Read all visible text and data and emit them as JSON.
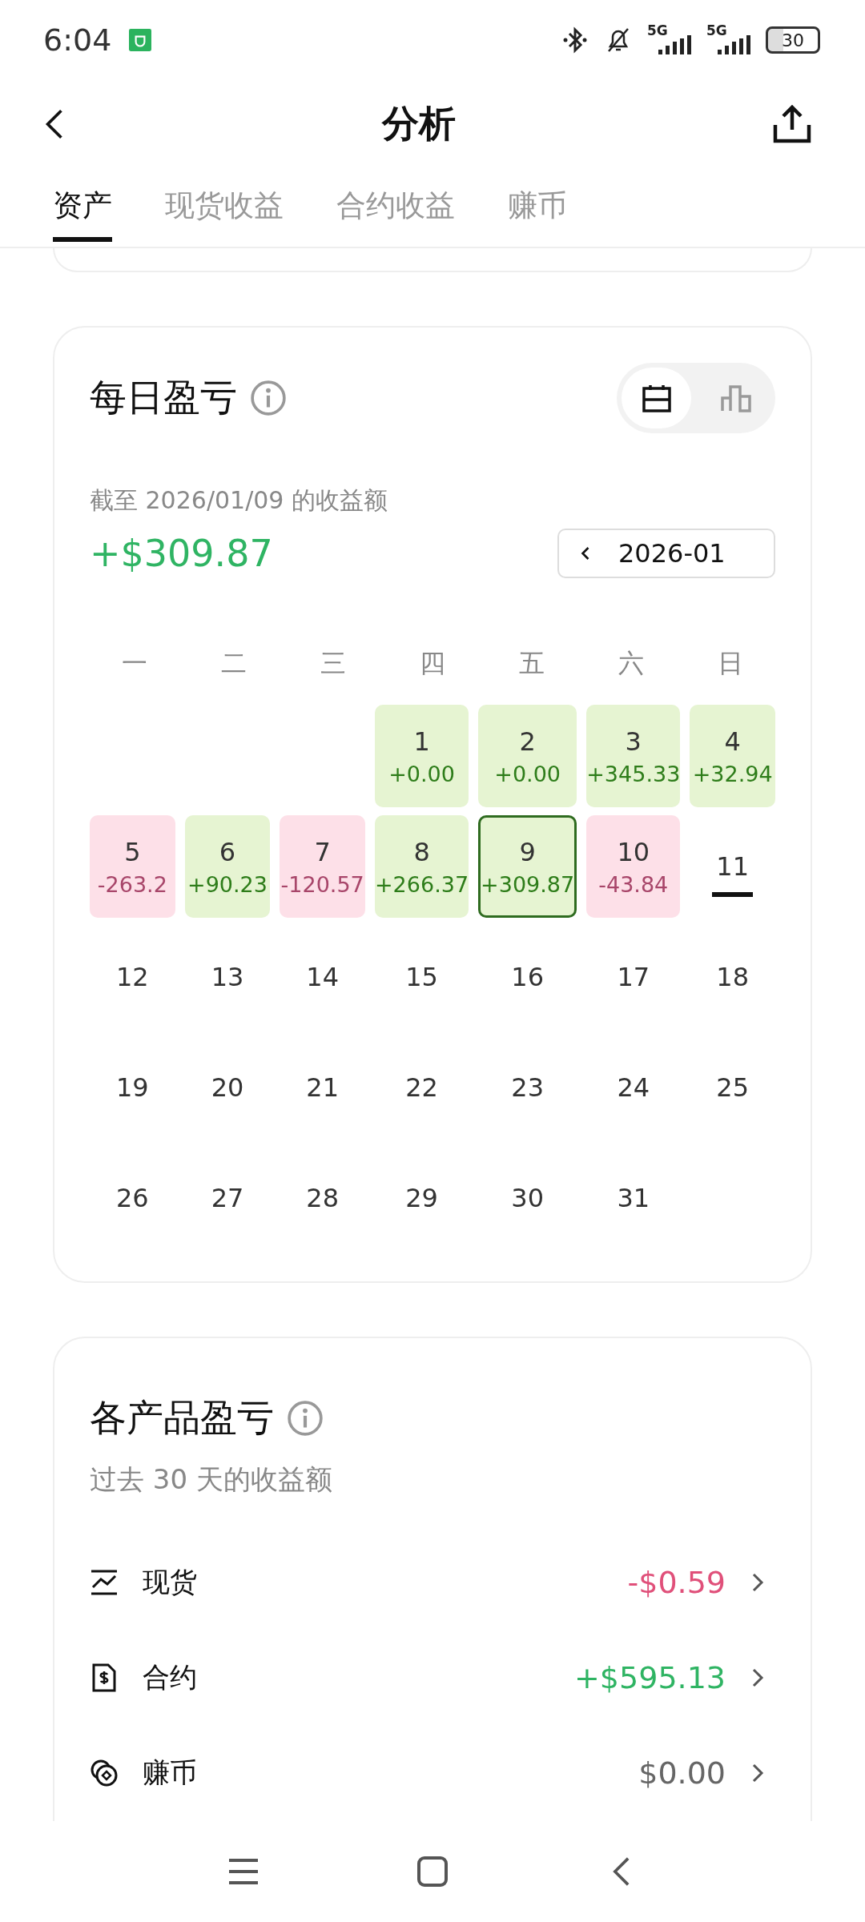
{
  "status_bar": {
    "time": "6:04",
    "sim_1": "5G",
    "sim_2": "5G",
    "battery": "30"
  },
  "header": {
    "title": "分析"
  },
  "tabs": [
    {
      "label": "资产",
      "selected": true
    },
    {
      "label": "现货收益",
      "selected": false
    },
    {
      "label": "合约收益",
      "selected": false
    },
    {
      "label": "赚币",
      "selected": false
    }
  ],
  "daily_pnl": {
    "title": "每日盈亏",
    "view_toggle": [
      {
        "kind": "calendar",
        "selected": true
      },
      {
        "kind": "bars",
        "selected": false
      }
    ],
    "subtitle": "截至 2026/01/09 的收益额",
    "amount": "+$309.87",
    "month": "2026-01",
    "weekdays": [
      "一",
      "二",
      "三",
      "四",
      "五",
      "六",
      "日"
    ],
    "days": [
      {
        "kind": "blank"
      },
      {
        "kind": "blank"
      },
      {
        "kind": "blank"
      },
      {
        "kind": "gain",
        "day": "1",
        "value": "+0.00",
        "selected": false,
        "today": false
      },
      {
        "kind": "gain",
        "day": "2",
        "value": "+0.00",
        "selected": false,
        "today": false
      },
      {
        "kind": "gain",
        "day": "3",
        "value": "+345.33",
        "selected": false,
        "today": false
      },
      {
        "kind": "gain",
        "day": "4",
        "value": "+32.94",
        "selected": false,
        "today": false
      },
      {
        "kind": "loss",
        "day": "5",
        "value": "-263.2",
        "selected": false,
        "today": false
      },
      {
        "kind": "gain",
        "day": "6",
        "value": "+90.23",
        "selected": false,
        "today": false
      },
      {
        "kind": "loss",
        "day": "7",
        "value": "-120.57",
        "selected": false,
        "today": false
      },
      {
        "kind": "gain",
        "day": "8",
        "value": "+266.37",
        "selected": false,
        "today": false
      },
      {
        "kind": "gain",
        "day": "9",
        "value": "+309.87",
        "selected": true,
        "today": false
      },
      {
        "kind": "loss",
        "day": "10",
        "value": "-43.84",
        "selected": false,
        "today": false
      },
      {
        "kind": "plain",
        "day": "11",
        "selected": false,
        "today": true
      },
      {
        "kind": "plain",
        "day": "12",
        "selected": false,
        "today": false
      },
      {
        "kind": "plain",
        "day": "13",
        "selected": false,
        "today": false
      },
      {
        "kind": "plain",
        "day": "14",
        "selected": false,
        "today": false
      },
      {
        "kind": "plain",
        "day": "15",
        "selected": false,
        "today": false
      },
      {
        "kind": "plain",
        "day": "16",
        "selected": false,
        "today": false
      },
      {
        "kind": "plain",
        "day": "17",
        "selected": false,
        "today": false
      },
      {
        "kind": "plain",
        "day": "18",
        "selected": false,
        "today": false
      },
      {
        "kind": "plain",
        "day": "19",
        "selected": false,
        "today": false
      },
      {
        "kind": "plain",
        "day": "20",
        "selected": false,
        "today": false
      },
      {
        "kind": "plain",
        "day": "21",
        "selected": false,
        "today": false
      },
      {
        "kind": "plain",
        "day": "22",
        "selected": false,
        "today": false
      },
      {
        "kind": "plain",
        "day": "23",
        "selected": false,
        "today": false
      },
      {
        "kind": "plain",
        "day": "24",
        "selected": false,
        "today": false
      },
      {
        "kind": "plain",
        "day": "25",
        "selected": false,
        "today": false
      },
      {
        "kind": "plain",
        "day": "26",
        "selected": false,
        "today": false
      },
      {
        "kind": "plain",
        "day": "27",
        "selected": false,
        "today": false
      },
      {
        "kind": "plain",
        "day": "28",
        "selected": false,
        "today": false
      },
      {
        "kind": "plain",
        "day": "29",
        "selected": false,
        "today": false
      },
      {
        "kind": "plain",
        "day": "30",
        "selected": false,
        "today": false
      },
      {
        "kind": "plain",
        "day": "31",
        "selected": false,
        "today": false
      }
    ]
  },
  "product_pnl": {
    "title": "各产品盈亏",
    "subtitle": "过去 30 天的收益额",
    "rows": [
      {
        "kind": "spot",
        "name": "现货",
        "value": "-$0.59",
        "color": "#e0507a"
      },
      {
        "kind": "contract",
        "name": "合约",
        "value": "+$595.13",
        "color": "#2fb463"
      },
      {
        "kind": "earn",
        "name": "赚币",
        "value": "$0.00",
        "color": "#666666"
      }
    ]
  }
}
